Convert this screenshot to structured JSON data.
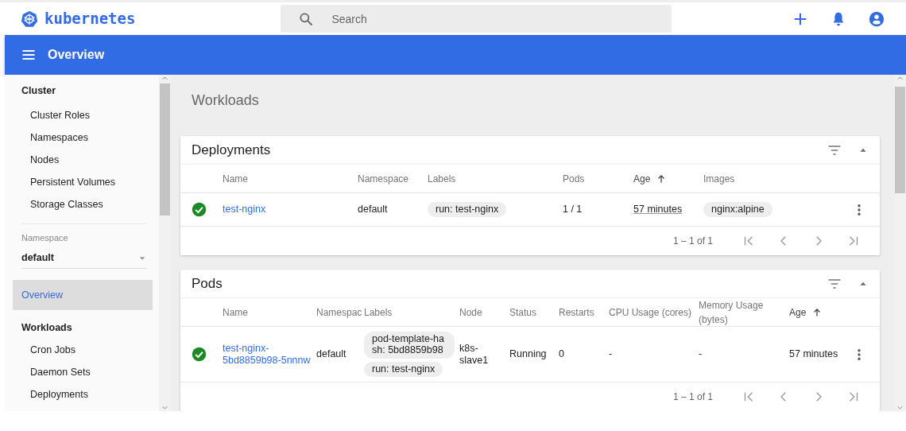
{
  "header": {
    "logo_text": "kubernetes",
    "search": {
      "placeholder": "Search"
    }
  },
  "toolbar": {
    "title": "Overview"
  },
  "sidebar": {
    "cluster": {
      "title": "Cluster",
      "items": [
        {
          "label": "Cluster Roles",
          "selected": false
        },
        {
          "label": "Namespaces",
          "selected": false
        },
        {
          "label": "Nodes",
          "selected": false
        },
        {
          "label": "Persistent Volumes",
          "selected": false
        },
        {
          "label": "Storage Classes",
          "selected": false
        }
      ]
    },
    "namespace": {
      "label": "Namespace",
      "value": "default"
    },
    "nav": [
      {
        "label": "Overview",
        "kind": "top",
        "selected": true
      },
      {
        "label": "Workloads",
        "kind": "heading",
        "selected": false
      },
      {
        "label": "Cron Jobs",
        "kind": "item",
        "selected": false
      },
      {
        "label": "Daemon Sets",
        "kind": "item",
        "selected": false
      },
      {
        "label": "Deployments",
        "kind": "item",
        "selected": false
      }
    ]
  },
  "main": {
    "title": "Workloads",
    "cards": [
      {
        "title": "Deployments",
        "columns": [
          {
            "label": "Name",
            "sorted": false
          },
          {
            "label": "Namespace",
            "sorted": false
          },
          {
            "label": "Labels",
            "sorted": false
          },
          {
            "label": "Pods",
            "sorted": false
          },
          {
            "label": "Age",
            "sorted": true
          },
          {
            "label": "Images",
            "sorted": false
          }
        ],
        "rows": [
          {
            "ready": true,
            "cells": [
              {
                "kind": "link",
                "text": "test-nginx"
              },
              {
                "kind": "text",
                "text": "default"
              },
              {
                "kind": "chips",
                "chips": [
                  "run: test-nginx"
                ]
              },
              {
                "kind": "text",
                "text": "1 / 1"
              },
              {
                "kind": "age",
                "text": "57 minutes"
              },
              {
                "kind": "chips",
                "chips": [
                  "nginx:alpine"
                ]
              }
            ]
          }
        ],
        "pagination": "1 – 1 of 1"
      },
      {
        "title": "Pods",
        "columns": [
          {
            "label": "Name",
            "sorted": false
          },
          {
            "label": "Namespac",
            "sorted": false
          },
          {
            "label": "Labels",
            "sorted": false
          },
          {
            "label": "Node",
            "sorted": false
          },
          {
            "label": "Status",
            "sorted": false
          },
          {
            "label": "Restarts",
            "sorted": false
          },
          {
            "label": "CPU Usage (cores)",
            "sorted": false
          },
          {
            "label": "Memory Usage (bytes)",
            "sorted": false
          },
          {
            "label": "Age",
            "sorted": true
          }
        ],
        "rows": [
          {
            "ready": true,
            "cells": [
              {
                "kind": "link",
                "text": "test-nginx-5bd8859b98-5nnnw"
              },
              {
                "kind": "text",
                "text": "default"
              },
              {
                "kind": "chips",
                "chips": [
                  "pod-template-hash: 5bd8859b98",
                  "run: test-nginx"
                ]
              },
              {
                "kind": "text",
                "text": "k8s-slave1"
              },
              {
                "kind": "text",
                "text": "Running"
              },
              {
                "kind": "text",
                "text": "0"
              },
              {
                "kind": "text",
                "text": "-"
              },
              {
                "kind": "text",
                "text": "-"
              },
              {
                "kind": "text",
                "text": "57 minutes"
              }
            ]
          }
        ],
        "pagination": "1 – 1 of 1"
      }
    ]
  }
}
